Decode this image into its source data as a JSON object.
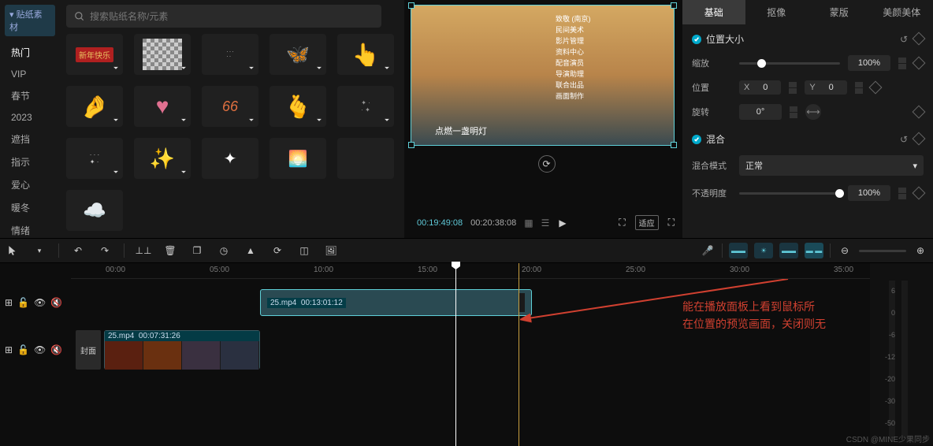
{
  "sidebar": {
    "dropdown": "贴纸素材",
    "cats": [
      "热门",
      "VIP",
      "春节",
      "2023",
      "遮挡",
      "指示",
      "爱心",
      "暖冬",
      "情绪"
    ]
  },
  "search": {
    "placeholder": "搜索贴纸名称/元素"
  },
  "stickers": {
    "happy_ny": "新年快乐"
  },
  "preview": {
    "subtitle": "点燃一盏明灯",
    "credits": "致敬 (南京)\n民间美术\n影片管理\n资料中心\n配音演员\n导演助理\n联合出品\n画面制作",
    "cur": "00:19:49:08",
    "dur": "00:20:38:08",
    "fit": "适应"
  },
  "props": {
    "tabs": [
      "基础",
      "抠像",
      "蒙版",
      "美颜美体"
    ],
    "sec1": "位置大小",
    "scale_lbl": "缩放",
    "scale_val": "100%",
    "pos_lbl": "位置",
    "x_lbl": "X",
    "x_val": "0",
    "y_lbl": "Y",
    "y_val": "0",
    "rot_lbl": "旋转",
    "rot_val": "0°",
    "sec2": "混合",
    "blend_lbl": "混合模式",
    "blend_val": "正常",
    "opacity_lbl": "不透明度",
    "opacity_val": "100%"
  },
  "timeline": {
    "ticks": [
      "00:00",
      "05:00",
      "10:00",
      "15:00",
      "20:00",
      "25:00",
      "30:00",
      "35:00"
    ],
    "clip1": {
      "name": "25.mp4",
      "dur": "00:13:01:12"
    },
    "clip2": {
      "name": "25.mp4",
      "dur": "00:07:31:26"
    },
    "cover": "封面"
  },
  "meter": {
    "labels": [
      "6",
      "0",
      "-6",
      "-12",
      "-20",
      "-30",
      "-50"
    ]
  },
  "annotation": "能在播放面板上看到鼠标所\n在位置的预览画面，关闭则无",
  "watermark": "CSDN @MINE少果同步"
}
